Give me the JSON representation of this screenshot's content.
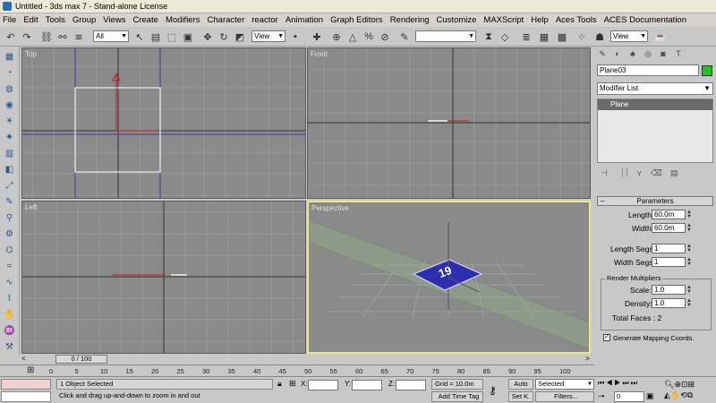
{
  "window": {
    "title": "Untitled - 3ds max 7 - Stand-alone License"
  },
  "menu": [
    "File",
    "Edit",
    "Tools",
    "Group",
    "Views",
    "Create",
    "Modifiers",
    "Character",
    "reactor",
    "Animation",
    "Graph Editors",
    "Rendering",
    "Customize",
    "MAXScript",
    "Help",
    "Aces Tools",
    "ACES Documentation"
  ],
  "toolbar": {
    "selection_filter": "All",
    "ref_coord": "View",
    "named_selection": "",
    "render_view": "View"
  },
  "viewports": {
    "top": "Top",
    "front": "Front",
    "left": "Left",
    "perspective": "Perspective"
  },
  "perspective_object": {
    "label": "19",
    "color": "#2e2fb0"
  },
  "panel": {
    "object_name": "Plane03",
    "object_color": "#22c422",
    "modifier_list": "Modifier List",
    "stack_item": "Plane",
    "rollout_title": "Parameters",
    "length_label": "Length:",
    "length_value": "60.0m",
    "width_label": "Width:",
    "width_value": "60.0m",
    "length_segs_label": "Length Segs:",
    "length_segs_value": "1",
    "width_segs_label": "Width Segs:",
    "width_segs_value": "1",
    "render_multipliers_label": "Render Multipliers",
    "scale_label": "Scale:",
    "scale_value": "1.0",
    "density_label": "Density:",
    "density_value": "1.0",
    "total_faces": "Total Faces : 2",
    "gen_mapping_label": "Generate Mapping Coords.",
    "gen_mapping_checked": "✓"
  },
  "timeline": {
    "slider": "0 / 100",
    "ticks": [
      "0",
      "5",
      "10",
      "15",
      "20",
      "25",
      "30",
      "35",
      "40",
      "45",
      "50",
      "55",
      "60",
      "65",
      "70",
      "75",
      "80",
      "85",
      "90",
      "95",
      "100"
    ]
  },
  "status": {
    "selection": "1 Object Selected",
    "prompt": "Click and drag up-and-down to zoom in and out",
    "x_label": "X:",
    "y_label": "Y:",
    "z_label": "Z:",
    "grid": "Grid = 10.0m",
    "add_time_tag": "Add Time Tag",
    "auto": "Auto",
    "set_key": "Set K.",
    "key_filter": "Selected",
    "filters": "Filters...",
    "frame": "0"
  }
}
